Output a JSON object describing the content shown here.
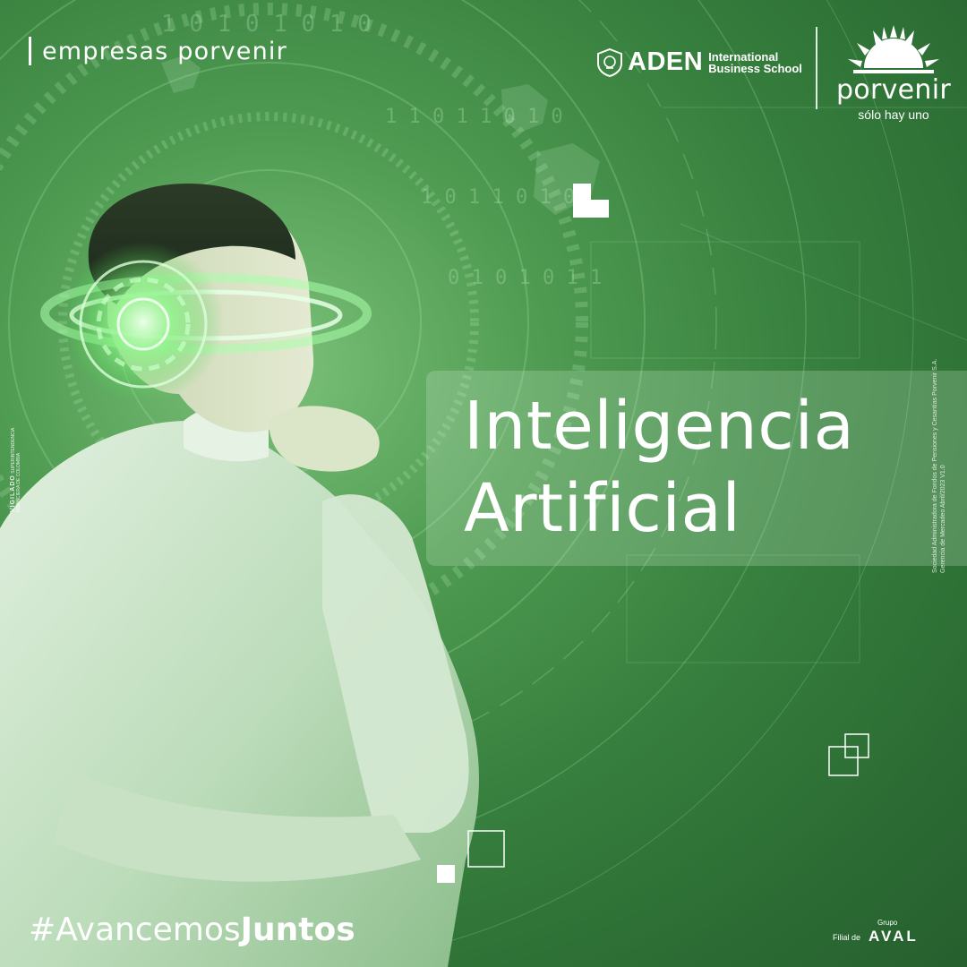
{
  "brand": {
    "left_label": "empresas porvenir",
    "aden_name": "ADEN",
    "aden_line1": "International",
    "aden_line2": "Business School",
    "porvenir_name": "porvenir",
    "porvenir_tagline": "sólo hay uno"
  },
  "headline": {
    "line1": "Inteligencia",
    "line2": "Artificial"
  },
  "legal": {
    "right_line1": "Sociedad Administradora de Fondos de Pensiones y Cesantías Porvenir S.A.",
    "right_line2": "Gerencia de Mercadeo Abril/2023 V1.0",
    "vigilado_label": "VIGILADO",
    "vigilado_sub": "SUPERINTENDENCIA FINANCIERA DE COLOMBIA"
  },
  "footer": {
    "hashtag_prefix": "#Avancemos",
    "hashtag_bold": "Juntos",
    "filial": "Filial de",
    "grupo": "Grupo",
    "aval": "AVAL"
  },
  "colors": {
    "background": "#37803e",
    "glow": "#7cf27c",
    "text": "#ffffff"
  },
  "icons": [
    "aden-shield-icon",
    "porvenir-sun-icon"
  ]
}
